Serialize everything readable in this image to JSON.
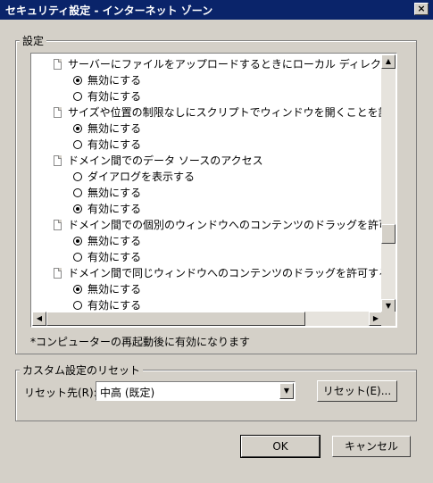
{
  "window": {
    "title": "セキュリティ設定 - インターネット ゾーン",
    "close_glyph": "×"
  },
  "settings_group": {
    "label": "設定",
    "rows": [
      {
        "type": "setting",
        "label": "サーバーにファイルをアップロードするときにローカル ディレクトリのパスを含める"
      },
      {
        "type": "option",
        "label": "無効にする",
        "checked": true
      },
      {
        "type": "option",
        "label": "有効にする",
        "checked": false
      },
      {
        "type": "setting",
        "label": "サイズや位置の制限なしにスクリプトでウィンドウを開くことを許可する"
      },
      {
        "type": "option",
        "label": "無効にする",
        "checked": true
      },
      {
        "type": "option",
        "label": "有効にする",
        "checked": false
      },
      {
        "type": "setting",
        "label": "ドメイン間でのデータ ソースのアクセス"
      },
      {
        "type": "option",
        "label": "ダイアログを表示する",
        "checked": false
      },
      {
        "type": "option",
        "label": "無効にする",
        "checked": false
      },
      {
        "type": "option",
        "label": "有効にする",
        "checked": true
      },
      {
        "type": "setting",
        "label": "ドメイン間での個別のウィンドウへのコンテンツのドラッグを許可する"
      },
      {
        "type": "option",
        "label": "無効にする",
        "checked": true
      },
      {
        "type": "option",
        "label": "有効にする",
        "checked": false
      },
      {
        "type": "setting",
        "label": "ドメイン間で同じウィンドウへのコンテンツのドラッグを許可する"
      },
      {
        "type": "option",
        "label": "無効にする",
        "checked": true
      },
      {
        "type": "option",
        "label": "有効にする",
        "checked": false
      }
    ],
    "restart_note": "*コンピューターの再起動後に有効になります"
  },
  "reset_group": {
    "label": "カスタム設定のリセット",
    "reset_to_label": "リセット先(R):",
    "reset_to_value": "中高 (既定)",
    "reset_button": "リセット(E)..."
  },
  "buttons": {
    "ok": "OK",
    "cancel": "キャンセル"
  },
  "icons": {
    "scroll_up": "▲",
    "scroll_down": "▼",
    "scroll_left": "◀",
    "scroll_right": "▶",
    "dropdown": "▼"
  }
}
